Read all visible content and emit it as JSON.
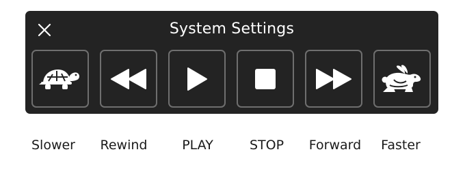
{
  "window": {
    "title": "System Settings"
  },
  "controls": [
    {
      "label": "Slower",
      "icon": "turtle-icon"
    },
    {
      "label": "Rewind",
      "icon": "rewind-icon"
    },
    {
      "label": "PLAY",
      "icon": "play-icon"
    },
    {
      "label": "STOP",
      "icon": "stop-icon"
    },
    {
      "label": "Forward",
      "icon": "fast-forward-icon"
    },
    {
      "label": "Faster",
      "icon": "rabbit-icon"
    }
  ],
  "colors": {
    "panel_background": "#232323",
    "button_border": "#6f6f6f",
    "icon": "#ffffff",
    "label_text": "#1a1a1a"
  }
}
